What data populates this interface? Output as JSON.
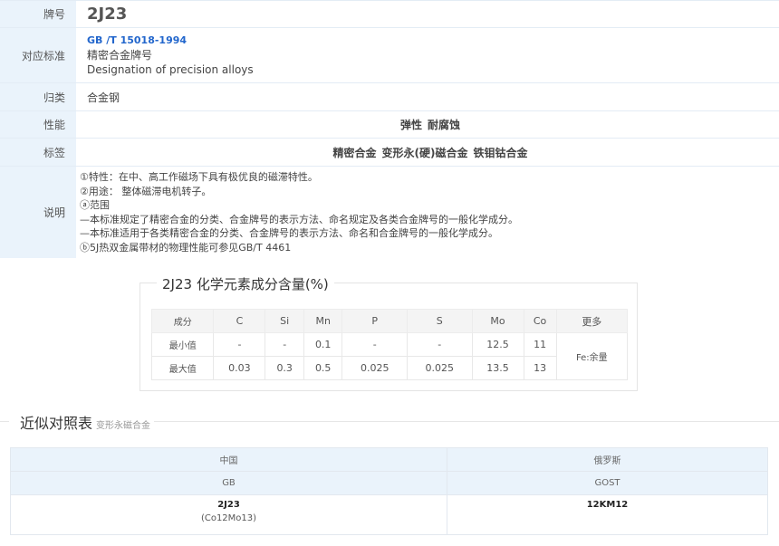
{
  "info": {
    "brand_label": "牌号",
    "brand_value": "2J23",
    "standard_label": "对应标准",
    "standard_code": "GB /T 15018-1994",
    "standard_name_cn": "精密合金牌号",
    "standard_name_en": "Designation of precision alloys",
    "category_label": "归类",
    "category_value": "合金钢",
    "property_label": "性能",
    "property_tags": [
      "弹性",
      "耐腐蚀"
    ],
    "tag_label": "标签",
    "tags": [
      "精密合金",
      "变形永(硬)磁合金",
      "铁钼钴合金"
    ],
    "desc_label": "说明",
    "desc_lines": [
      "①特性：在中、高工作磁场下具有极优良的磁滞特性。",
      "②用途： 整体磁滞电机转子。",
      "ⓐ范围",
      "—本标准规定了精密合金的分类、合金牌号的表示方法、命名规定及各类合金牌号的一般化学成分。",
      "—本标准适用于各类精密合金的分类、合金牌号的表示方法、命名和合金牌号的一般化学成分。",
      "ⓑ5J热双金属带材的物理性能可参见GB/T 4461"
    ]
  },
  "composition": {
    "title": "2J23 化学元素成分含量(%)",
    "headers": [
      "成分",
      "C",
      "Si",
      "Mn",
      "P",
      "S",
      "Mo",
      "Co",
      "更多"
    ],
    "rows": [
      {
        "label": "最小值",
        "values": [
          "-",
          "-",
          "0.1",
          "-",
          "-",
          "12.5",
          "11"
        ]
      },
      {
        "label": "最大值",
        "values": [
          "0.03",
          "0.3",
          "0.5",
          "0.025",
          "0.025",
          "13.5",
          "13"
        ]
      }
    ],
    "more": "Fe:余量"
  },
  "comparison": {
    "title": "近似对照表",
    "subtitle": "变形永磁合金",
    "countries": [
      "中国",
      "俄罗斯"
    ],
    "standards": [
      "GB",
      "GOST"
    ],
    "grades": [
      {
        "name": "2J23",
        "sub": "(Co12Mo13)"
      },
      {
        "name": "12KM12",
        "sub": ""
      }
    ]
  }
}
